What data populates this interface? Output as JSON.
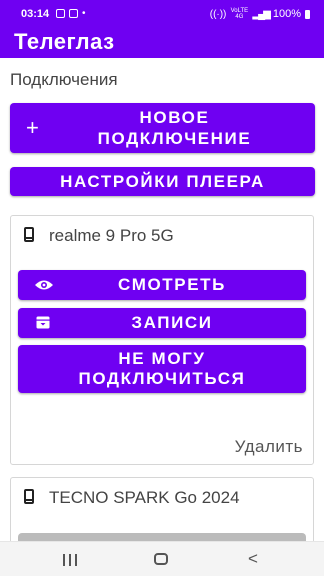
{
  "status_bar": {
    "time": "03:14",
    "network_label": "VoLTE 4G",
    "battery": "100%",
    "icons": [
      "gallery-icon",
      "screenshot-icon",
      "dot-icon",
      "hotspot-icon",
      "signal-icon",
      "battery-icon"
    ]
  },
  "app": {
    "title": "Телеглаз",
    "accent_color": "#6f00f2"
  },
  "main": {
    "section_label": "Подключения",
    "new_connection": {
      "icon": "+",
      "line1": "Новое",
      "line2": "подключение"
    },
    "player_settings": "Настройки плеера"
  },
  "devices": [
    {
      "name": "realme 9 Pro 5G",
      "watch": "Смотреть",
      "records": "Записи",
      "cant_connect_line1": "Не могу",
      "cant_connect_line2": "подключиться",
      "delete": "Удалить"
    },
    {
      "name": "TECNO SPARK Go 2024"
    }
  ],
  "nav_bar": {
    "back_glyph": "<"
  }
}
